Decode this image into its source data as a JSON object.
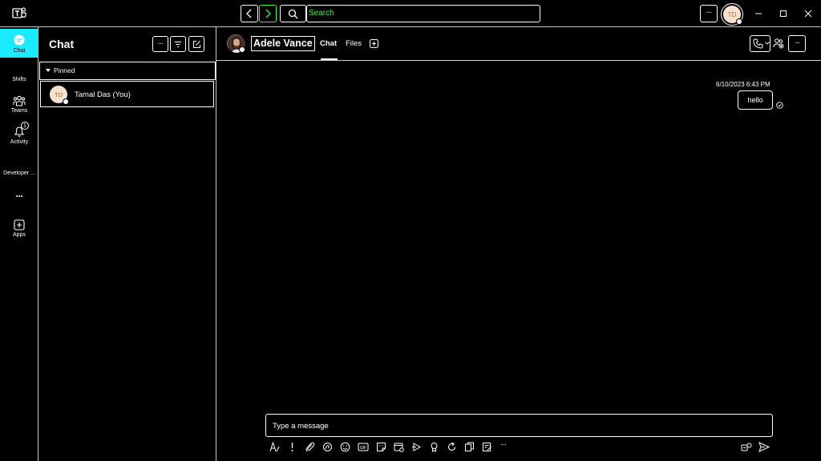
{
  "app": {
    "logo_icon": "teams-logo-icon"
  },
  "titlebar": {
    "search_placeholder": "Search",
    "more_label": "···",
    "profile_initials": "TD"
  },
  "rail": {
    "items": [
      {
        "label": "Chat",
        "icon": "chat-icon",
        "active": true
      },
      {
        "label": "Shifts",
        "icon": ""
      },
      {
        "label": "Teams",
        "icon": "teams-icon"
      },
      {
        "label": "Activity",
        "icon": "bell-icon",
        "badge": "1"
      },
      {
        "label": "Developer ...",
        "icon": ""
      },
      {
        "label": "···",
        "icon": "more-icon"
      },
      {
        "label": "Apps",
        "icon": "add-apps-icon"
      }
    ]
  },
  "chatlist": {
    "title": "Chat",
    "section": "Pinned",
    "items": [
      {
        "initials": "TD",
        "name": "Tamal Das (You)"
      }
    ]
  },
  "conversation": {
    "contact_name": "Adele Vance",
    "tabs": [
      {
        "label": "Chat",
        "active": true
      },
      {
        "label": "Files",
        "active": false
      }
    ],
    "messages": [
      {
        "timestamp": "6/10/2023 6:43 PM",
        "text": "hello",
        "status": "sent"
      }
    ],
    "compose_placeholder": "Type a message",
    "more_label": "···"
  },
  "colors": {
    "accent_green": "#3ff23f",
    "active_cyan": "#1aebff",
    "background": "#000000",
    "avatar_bg": "#f6e2cf",
    "avatar_text": "#c1652b"
  }
}
